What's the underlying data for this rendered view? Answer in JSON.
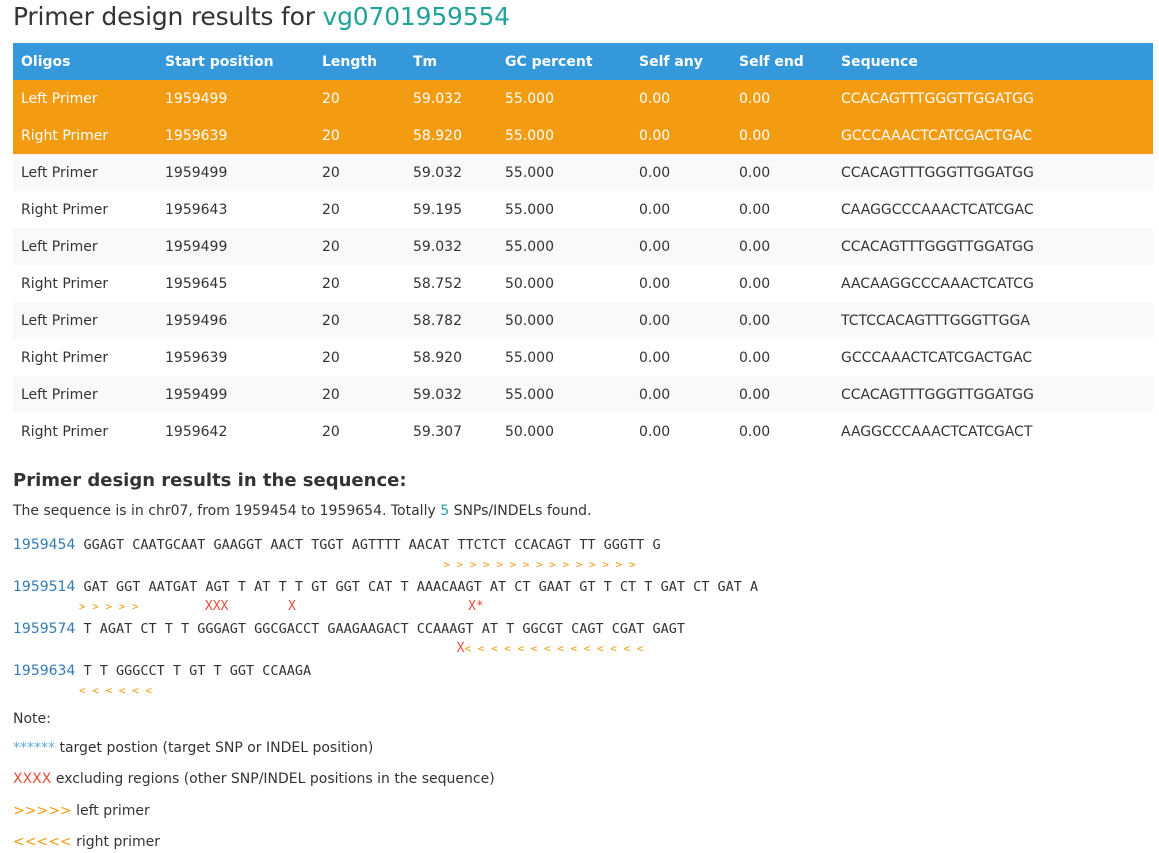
{
  "title": {
    "prefix": "Primer design results for ",
    "gene_id": "vg0701959554"
  },
  "table": {
    "headers": [
      "Oligos",
      "Start position",
      "Length",
      "Tm",
      "GC percent",
      "Self any",
      "Self end",
      "Sequence"
    ],
    "rows": [
      [
        "Left Primer",
        "1959499",
        "20",
        "59.032",
        "55.000",
        "0.00",
        "0.00",
        "CCACAGTTTGGGTTGGATGG"
      ],
      [
        "Right Primer",
        "1959639",
        "20",
        "58.920",
        "55.000",
        "0.00",
        "0.00",
        "GCCCAAACTCATCGACTGAC"
      ],
      [
        "Left Primer",
        "1959499",
        "20",
        "59.032",
        "55.000",
        "0.00",
        "0.00",
        "CCACAGTTTGGGTTGGATGG"
      ],
      [
        "Right Primer",
        "1959643",
        "20",
        "59.195",
        "55.000",
        "0.00",
        "0.00",
        "CAAGGCCCAAACTCATCGAC"
      ],
      [
        "Left Primer",
        "1959499",
        "20",
        "59.032",
        "55.000",
        "0.00",
        "0.00",
        "CCACAGTTTGGGTTGGATGG"
      ],
      [
        "Right Primer",
        "1959645",
        "20",
        "58.752",
        "50.000",
        "0.00",
        "0.00",
        "AACAAGGCCCAAACTCATCG"
      ],
      [
        "Left Primer",
        "1959496",
        "20",
        "58.782",
        "50.000",
        "0.00",
        "0.00",
        "TCTCCACAGTTTGGGTTGGA"
      ],
      [
        "Right Primer",
        "1959639",
        "20",
        "58.920",
        "55.000",
        "0.00",
        "0.00",
        "GCCCAAACTCATCGACTGAC"
      ],
      [
        "Left Primer",
        "1959499",
        "20",
        "59.032",
        "55.000",
        "0.00",
        "0.00",
        "CCACAGTTTGGGTTGGATGG"
      ],
      [
        "Right Primer",
        "1959642",
        "20",
        "59.307",
        "50.000",
        "0.00",
        "0.00",
        "AAGGCCCAAACTCATCGACT"
      ]
    ]
  },
  "sequence_section": {
    "heading": "Primer design results in the sequence:",
    "summary_prefix": "The sequence is in chr07, from 1959454 to 1959654. Totally ",
    "snp_count": "5",
    "summary_suffix": " SNPs/INDELs found.",
    "lines": [
      {
        "pos": "1959454",
        "seq": "GGAGT CAATGCAAT GAAGGT AACT TGGT AGTTTT AACAT TTCTCT CCACAGT TT GGGTT G",
        "marks": "                                                       > > > > > > > > > > > > > > >"
      },
      {
        "pos": "1959514",
        "seq": "GAT GGT AATGAT AGT T AT T T GT GGT CAT T AAACAAGT AT CT GAAT GT T CT T GAT CT GAT A",
        "marks": "> > > > >          XXX         X                          X*"
      },
      {
        "pos": "1959574",
        "seq": "T AGAT CT T T GGGAGT GGCGACCT GAAGAAGACT CCAAAGT AT T GGCGT CAGT CGAT GAGT",
        "marks": "                                                         X< < < < < < < < < < < < < <"
      },
      {
        "pos": "1959634",
        "seq": "T T GGGCCT T GT T GGT CCAAGA",
        "marks": "< < < < < <"
      }
    ]
  },
  "notes": {
    "heading": "Note:",
    "target_symbol": "******",
    "target_text": " target postion (target SNP or INDEL position)",
    "exclude_symbol": "XXXX",
    "exclude_text": " excluding regions (other SNP/INDEL positions in the sequence)",
    "left_symbol": ">>>>>",
    "left_text": " left primer",
    "right_symbol": "<<<<<",
    "right_text": " right primer"
  },
  "colors": {
    "header_bg": "#3498db",
    "highlight_row": "#f39c12",
    "gene_id": "#1fa39a",
    "position": "#337ab7",
    "exclude": "#e74c3c"
  }
}
